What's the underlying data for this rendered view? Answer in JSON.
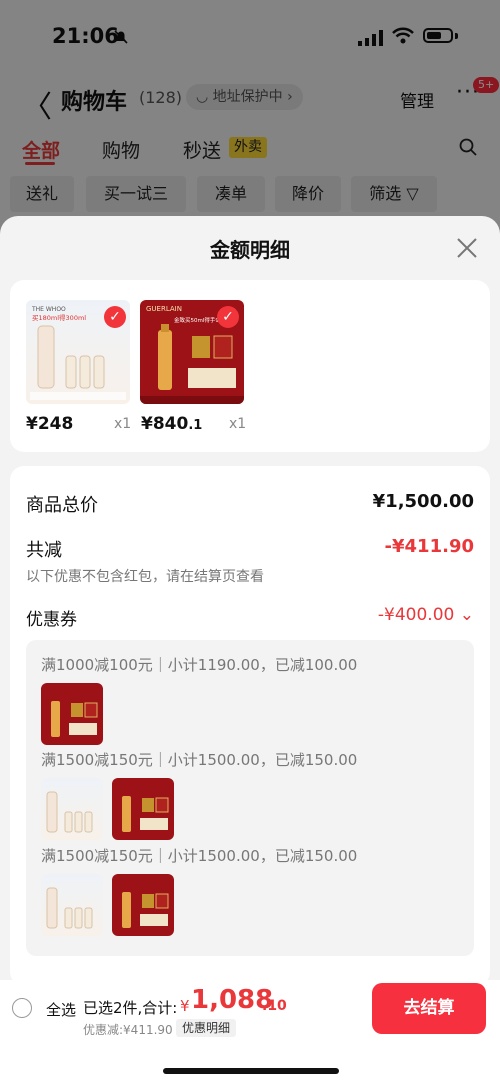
{
  "status_bar": {
    "time": "21:06"
  },
  "header": {
    "back_glyph": "〈",
    "title": "购物车",
    "count": "(128)",
    "address": "地址保护中",
    "address_chevron": "›",
    "manage": "管理",
    "more_glyph": "···",
    "badge": "5+"
  },
  "tabs": [
    {
      "label": "全部"
    },
    {
      "label": "购物"
    },
    {
      "label": "秒送"
    }
  ],
  "tab_tag": "外卖",
  "filters": [
    "送礼",
    "买一试三",
    "凑单",
    "降价",
    "筛选 ▽"
  ],
  "sheet": {
    "title": "金额明细",
    "close_glyph": "✕",
    "products": [
      {
        "price": "¥248",
        "qty": "x1"
      },
      {
        "price": "¥840",
        "price_dec": ".1",
        "qty": "x1"
      }
    ],
    "product_art": {
      "brand1": "THE WHOO",
      "promo1": "买180ml得300ml",
      "brand2": "GUERLAIN",
      "promo2": "金致买50ml得手90ml"
    },
    "total_label": "商品总价",
    "total_value": "¥1,500.00",
    "reduce_label": "共减",
    "reduce_value": "-¥411.90",
    "reduce_note": "以下优惠不包含红包，请在结算页查看",
    "coupon_label": "优惠券",
    "coupon_value": "-¥400.00",
    "coupon_chevron": "⌄",
    "coupons": [
      {
        "text": "满1000减100元｜小计1190.00，已减100.00"
      },
      {
        "text": "满1500减150元｜小计1500.00，已减150.00"
      },
      {
        "text": "满1500减150元｜小计1500.00，已减150.00"
      }
    ]
  },
  "bottom": {
    "select_all": "全选",
    "selected": "已选2件,合计:",
    "currency": "¥",
    "total_int": "1,088",
    "total_dec": ".10",
    "discount": "优惠减:¥411.90",
    "detail": "优惠明细",
    "checkout": "去结算"
  },
  "colors": {
    "accent": "#f6303e",
    "red_text": "#e9373a"
  }
}
